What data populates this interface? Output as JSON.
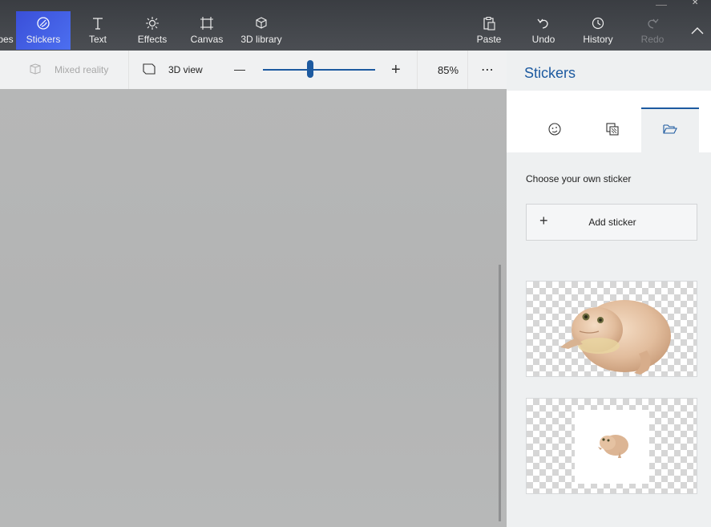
{
  "ribbon": {
    "left_cut_label": "pes",
    "stickers": "Stickers",
    "text": "Text",
    "effects": "Effects",
    "canvas": "Canvas",
    "library": "3D library",
    "paste": "Paste",
    "undo": "Undo",
    "history": "History",
    "redo": "Redo"
  },
  "toolbar": {
    "mixed_reality": "Mixed reality",
    "view_3d": "3D view",
    "zoom_level": "85%",
    "zoom_slider_fraction": 0.42
  },
  "panel": {
    "title": "Stickers",
    "tabs": [
      {
        "icon": "sticker-face-icon"
      },
      {
        "icon": "textures-icon"
      },
      {
        "icon": "folder-open-icon"
      }
    ],
    "choose_label": "Choose your own sticker",
    "add_sticker": "Add sticker"
  },
  "colors": {
    "accent": "#1d5aa0",
    "active_tab_gradient_start": "#3a4fd8",
    "ribbon_bg": "#3a3d42"
  }
}
